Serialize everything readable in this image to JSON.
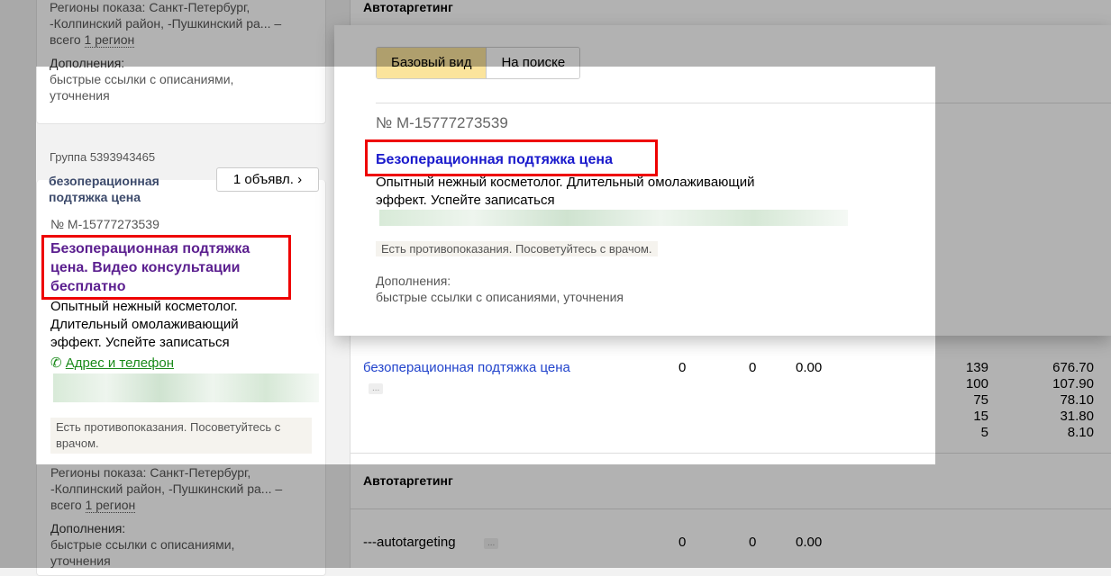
{
  "left": {
    "card1": {
      "regions_line1": "Регионы показа: Санкт-Петербург,",
      "regions_line2": "-Колпинский район, -Пушкинский ра... –",
      "regions_prefix": "всего ",
      "regions_link": "1 регион",
      "extras_label": "Дополнения:",
      "extras_line1": "быстрые ссылки с описаниями,",
      "extras_line2": "уточнения"
    },
    "group": {
      "label": "Группа 5393943465",
      "name_line1": "безоперационная",
      "name_line2": "подтяжка цена",
      "ads_button": "1 объявл."
    },
    "card2": {
      "number": "№ M-15777273539",
      "title_line1": "Безоперационная подтяжка",
      "title_line2": "цена. Видео консультации",
      "title_line3": "бесплатно",
      "text_line1": "Опытный нежный косметолог.",
      "text_line2": "Длительный омолаживающий",
      "text_line3": "эффект. Успейте записаться",
      "contact_link": "Адрес и телефон",
      "warning_line1": "Есть противопоказания. Посоветуйтесь с",
      "warning_line2": "врачом.",
      "regions_line1": "Регионы показа: Санкт-Петербург,",
      "regions_line2": "-Колпинский район, -Пушкинский ра... –",
      "regions_prefix": "всего ",
      "regions_link": "1 регион",
      "extras_label": "Дополнения:",
      "extras_line1": "быстрые ссылки с описаниями,",
      "extras_line2": "уточнения"
    }
  },
  "table": {
    "section1": "Автотаргетинг",
    "row1": {
      "phrase": "безоперационная подтяжка цена",
      "more": "...",
      "c1": "0",
      "c2": "0",
      "c3": "0.00",
      "bids": [
        "139",
        "100",
        "75",
        "15",
        "5"
      ],
      "prices": [
        "676.70",
        "107.90",
        "78.10",
        "31.80",
        "8.10"
      ]
    },
    "section2": "Автотаргетинг",
    "row2": {
      "phrase": "---autotargeting",
      "more": "...",
      "c1": "0",
      "c2": "0",
      "c3": "0.00"
    }
  },
  "popup": {
    "tabs": [
      "Базовый вид",
      "На поиске"
    ],
    "number": "№ M-15777273539",
    "title": "Безоперационная подтяжка цена",
    "text_line1": "Опытный нежный косметолог. Длительный омолаживающий",
    "text_line2": "эффект. Успейте записаться",
    "warning": "Есть противопоказания. Посоветуйтесь с врачом.",
    "extras_label": "Дополнения:",
    "extras": "быстрые ссылки с описаниями, уточнения"
  }
}
